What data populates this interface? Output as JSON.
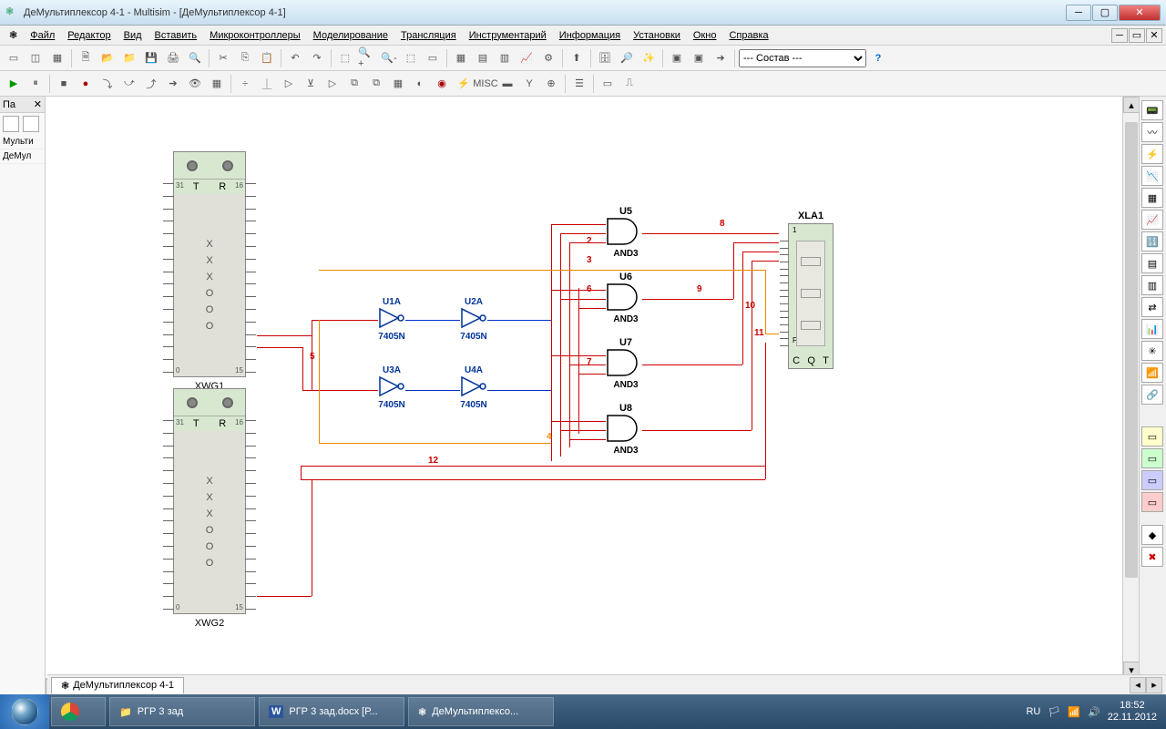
{
  "window": {
    "title": "ДеМультиплексор 4-1 - Multisim - [ДеМультиплексор 4-1]"
  },
  "menu": {
    "file": "Файл",
    "edit": "Редактор",
    "view": "Вид",
    "insert": "Вставить",
    "micro": "Микроконтроллеры",
    "model": "Моделирование",
    "trans": "Трансляция",
    "instr": "Инструментарий",
    "info": "Информация",
    "setup": "Установки",
    "window": "Окно",
    "help": "Справка"
  },
  "toolbar": {
    "compose": "--- Состав ---"
  },
  "leftpanel": {
    "hdr": "Пa",
    "item1": "Мульти",
    "item2": "ДеМул"
  },
  "schematic": {
    "xwg1": {
      "name": "XWG1",
      "T": "T",
      "R": "R",
      "tl": "31",
      "tr": "16",
      "bl": "0",
      "br": "15",
      "body": [
        "X",
        "X",
        "X",
        "O",
        "O",
        "O"
      ]
    },
    "xwg2": {
      "name": "XWG2",
      "T": "T",
      "R": "R",
      "tl": "31",
      "tr": "16",
      "bl": "0",
      "br": "15",
      "body": [
        "X",
        "X",
        "X",
        "O",
        "O",
        "O"
      ]
    },
    "u1a": {
      "name": "U1A",
      "type": "7405N"
    },
    "u2a": {
      "name": "U2A",
      "type": "7405N"
    },
    "u3a": {
      "name": "U3A",
      "type": "7405N"
    },
    "u4a": {
      "name": "U4A",
      "type": "7405N"
    },
    "u5": {
      "name": "U5",
      "type": "AND3"
    },
    "u6": {
      "name": "U6",
      "type": "AND3"
    },
    "u7": {
      "name": "U7",
      "type": "AND3"
    },
    "u8": {
      "name": "U8",
      "type": "AND3"
    },
    "xla1": {
      "name": "XLA1",
      "C": "C",
      "Q": "Q",
      "Tt": "T",
      "F": "F",
      "1": "1"
    },
    "nets": {
      "n2": "2",
      "n3": "3",
      "n4": "4",
      "n5": "5",
      "n6": "6",
      "n7": "7",
      "n8": "8",
      "n9": "9",
      "n10": "10",
      "n11": "11",
      "n12": "12"
    }
  },
  "tab": {
    "name": "ДеМультиплексор 4-1"
  },
  "taskbar": {
    "folder": "РГР 3 зад",
    "word": "РГР 3 зад.docx [Р...",
    "app": "ДеМультиплексо...",
    "lang": "RU",
    "time": "18:52",
    "date": "22.11.2012"
  }
}
